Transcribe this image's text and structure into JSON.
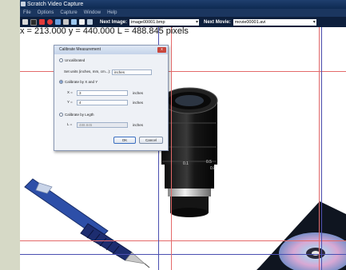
{
  "window": {
    "title": "Scratch Video Capture"
  },
  "menu": [
    "File",
    "Options",
    "Capture",
    "Window",
    "Help"
  ],
  "toolbar": {
    "next_image_label": "Next Image:",
    "next_image_value": "image00001.bmp",
    "next_movie_label": "Next Movie:",
    "next_movie_value": "movie00001.avi"
  },
  "readout": {
    "text": "x = 213.000  y = 440.000  L = 488.845 pixels"
  },
  "dialog": {
    "title": "Calibrate Measurement",
    "close_glyph": "x",
    "uncalibrated_label": "Uncalibrated",
    "set_units_label": "Set units (inches, mm, cm...):",
    "units_value": "inches",
    "calibrate_xy_label": "Calibrate by X and Y",
    "x_label": "X =",
    "x_value": "3",
    "x_unit": "inches",
    "y_label": "Y =",
    "y_value": "4",
    "y_unit": "inches",
    "calibrate_length_label": "Calibrate by Legth",
    "l_label": "L =",
    "l_value": "488.845",
    "l_unit": "inches",
    "ok_label": "OK",
    "cancel_label": "Cancel"
  },
  "lens": {
    "marks": [
      "0.1",
      "0.5",
      "0.8"
    ]
  },
  "colors": {
    "crosshair": "#e46a6a",
    "guide": "#4a4fb0",
    "titlebar": "#0e2a52"
  }
}
